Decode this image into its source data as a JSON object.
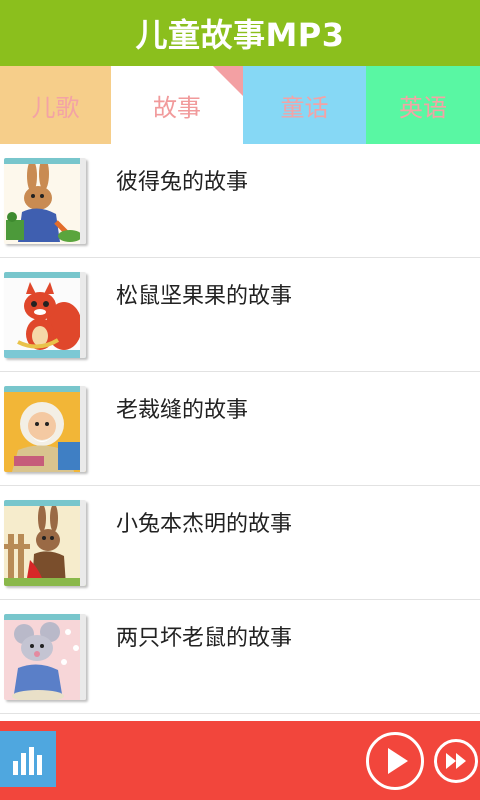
{
  "header": {
    "title": "儿童故事MP3"
  },
  "tabs": [
    {
      "label": "儿歌"
    },
    {
      "label": "故事"
    },
    {
      "label": "童话"
    },
    {
      "label": "英语"
    }
  ],
  "stories": [
    {
      "title": "彼得兔的故事",
      "thumb_icon": "rabbit-icon"
    },
    {
      "title": "松鼠坚果果的故事",
      "thumb_icon": "squirrel-icon"
    },
    {
      "title": "老裁缝的故事",
      "thumb_icon": "tailor-icon"
    },
    {
      "title": "小兔本杰明的故事",
      "thumb_icon": "bunny-icon"
    },
    {
      "title": "两只坏老鼠的故事",
      "thumb_icon": "mouse-icon"
    }
  ],
  "player": {
    "equalizer_icon": "equalizer-icon",
    "play_icon": "play-icon",
    "next_icon": "fast-forward-icon"
  },
  "colors": {
    "header_bg": "#8bbf1d",
    "player_bg": "#f2463c",
    "tab_er_ge": "#f6ce8a",
    "tab_tong_hua": "#86d8f5",
    "tab_ying_yu": "#59f7a3"
  }
}
